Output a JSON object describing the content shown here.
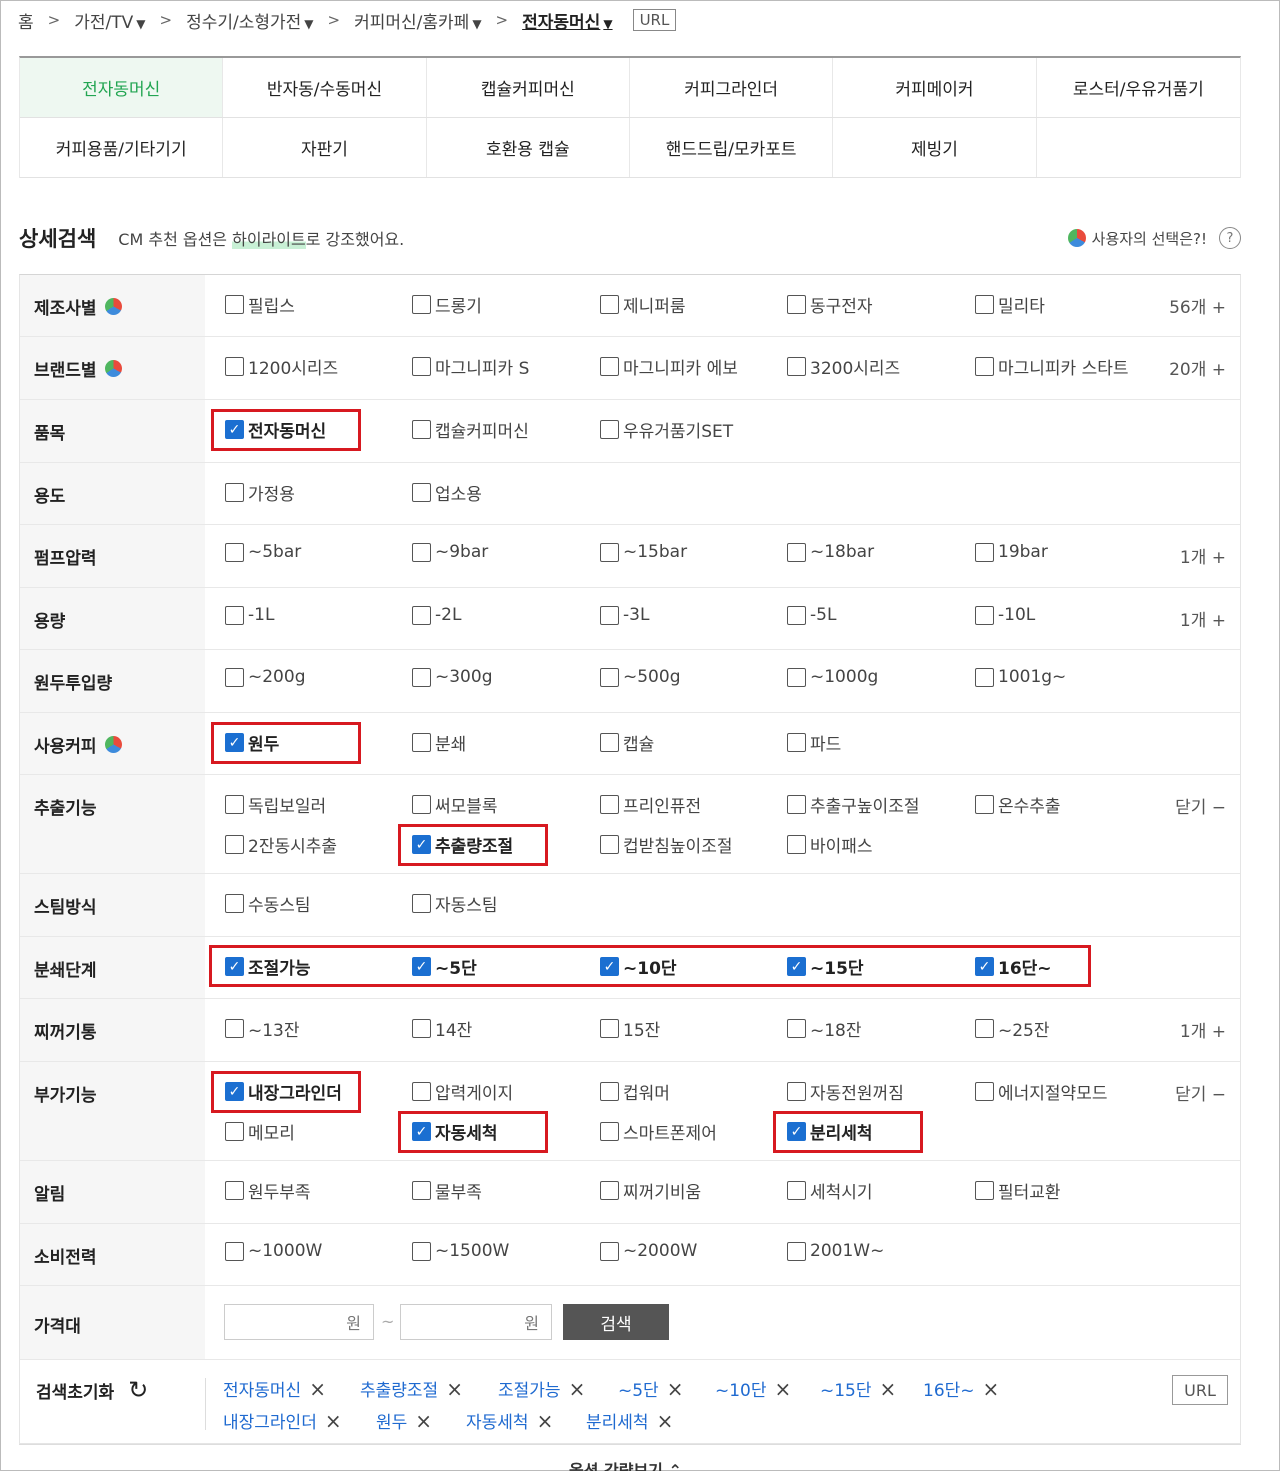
{
  "breadcrumb": {
    "home": "홈",
    "items": [
      "가전/TV",
      "정수기/소형가전",
      "커피머신/홈카페",
      "전자동머신"
    ],
    "url_label": "URL"
  },
  "categories": [
    [
      "전자동머신",
      "반자동/수동머신",
      "캡슐커피머신",
      "커피그라인더",
      "커피메이커",
      "로스터/우유거품기"
    ],
    [
      "커피용품/기타기기",
      "자판기",
      "호환용 캡슐",
      "핸드드립/모카포트",
      "제빙기",
      ""
    ]
  ],
  "detail": {
    "title": "상세검색",
    "note_pre": "CM 추천 옵션은 ",
    "note_hl": "하이라이트",
    "note_post": "로 강조했어요.",
    "user_choice": "사용자의 선택은?!",
    "help": "?"
  },
  "filters": [
    {
      "label": "제조사별",
      "pie": true,
      "more": "56개 +",
      "opts": [
        [
          "필립스",
          false
        ],
        [
          "드롱기",
          false
        ],
        [
          "제니퍼룸",
          false
        ],
        [
          "동구전자",
          false
        ],
        [
          "밀리타",
          false
        ]
      ]
    },
    {
      "label": "브랜드별",
      "pie": true,
      "more": "20개 +",
      "opts": [
        [
          "1200시리즈",
          false
        ],
        [
          "마그니피카 S",
          false
        ],
        [
          "마그니피카 에보",
          false
        ],
        [
          "3200시리즈",
          false
        ],
        [
          "마그니피카 스타트",
          false
        ]
      ]
    },
    {
      "label": "품목",
      "pie": false,
      "more": "",
      "opts": [
        [
          "전자동머신",
          true
        ],
        [
          "캡슐커피머신",
          false
        ],
        [
          "우유거품기SET",
          false
        ]
      ]
    },
    {
      "label": "용도",
      "pie": false,
      "more": "",
      "opts": [
        [
          "가정용",
          false
        ],
        [
          "업소용",
          false
        ]
      ]
    },
    {
      "label": "펌프압력",
      "pie": false,
      "more": "1개 +",
      "opts": [
        [
          "~5bar",
          false
        ],
        [
          "~9bar",
          false
        ],
        [
          "~15bar",
          false
        ],
        [
          "~18bar",
          false
        ],
        [
          "19bar",
          false
        ]
      ]
    },
    {
      "label": "용량",
      "pie": false,
      "more": "1개 +",
      "opts": [
        [
          "-1L",
          false
        ],
        [
          "-2L",
          false
        ],
        [
          "-3L",
          false
        ],
        [
          "-5L",
          false
        ],
        [
          "-10L",
          false
        ]
      ]
    },
    {
      "label": "원두투입량",
      "pie": false,
      "more": "",
      "opts": [
        [
          "~200g",
          false
        ],
        [
          "~300g",
          false
        ],
        [
          "~500g",
          false
        ],
        [
          "~1000g",
          false
        ],
        [
          "1001g~",
          false
        ]
      ]
    },
    {
      "label": "사용커피",
      "pie": true,
      "more": "",
      "opts": [
        [
          "원두",
          true
        ],
        [
          "분쇄",
          false
        ],
        [
          "캡슐",
          false
        ],
        [
          "파드",
          false
        ]
      ]
    },
    {
      "label": "추출기능",
      "pie": false,
      "more": "닫기 −",
      "opts": [
        [
          "독립보일러",
          false
        ],
        [
          "써모블록",
          false
        ],
        [
          "프리인퓨전",
          false
        ],
        [
          "추출구높이조절",
          false
        ],
        [
          "온수추출",
          false
        ],
        [
          "2잔동시추출",
          false
        ],
        [
          "추출량조절",
          true
        ],
        [
          "컵받침높이조절",
          false
        ],
        [
          "바이패스",
          false
        ]
      ]
    },
    {
      "label": "스팀방식",
      "pie": false,
      "more": "",
      "opts": [
        [
          "수동스팀",
          false
        ],
        [
          "자동스팀",
          false
        ]
      ]
    },
    {
      "label": "분쇄단계",
      "pie": false,
      "more": "",
      "opts": [
        [
          "조절가능",
          true
        ],
        [
          "~5단",
          true
        ],
        [
          "~10단",
          true
        ],
        [
          "~15단",
          true
        ],
        [
          "16단~",
          true
        ]
      ]
    },
    {
      "label": "찌꺼기통",
      "pie": false,
      "more": "1개 +",
      "opts": [
        [
          "~13잔",
          false
        ],
        [
          "14잔",
          false
        ],
        [
          "15잔",
          false
        ],
        [
          "~18잔",
          false
        ],
        [
          "~25잔",
          false
        ]
      ]
    },
    {
      "label": "부가기능",
      "pie": false,
      "more": "닫기 −",
      "opts": [
        [
          "내장그라인더",
          true
        ],
        [
          "압력게이지",
          false
        ],
        [
          "컵워머",
          false
        ],
        [
          "자동전원꺼짐",
          false
        ],
        [
          "에너지절약모드",
          false
        ],
        [
          "메모리",
          false
        ],
        [
          "자동세척",
          true
        ],
        [
          "스마트폰제어",
          false
        ],
        [
          "분리세척",
          true
        ]
      ]
    },
    {
      "label": "알림",
      "pie": false,
      "more": "",
      "opts": [
        [
          "원두부족",
          false
        ],
        [
          "물부족",
          false
        ],
        [
          "찌꺼기비움",
          false
        ],
        [
          "세척시기",
          false
        ],
        [
          "필터교환",
          false
        ]
      ]
    },
    {
      "label": "소비전력",
      "pie": false,
      "more": "",
      "opts": [
        [
          "~1000W",
          false
        ],
        [
          "~1500W",
          false
        ],
        [
          "~2000W",
          false
        ],
        [
          "2001W~",
          false
        ]
      ]
    }
  ],
  "price": {
    "label": "가격대",
    "unit_min": "원",
    "tilde": "~",
    "unit_max": "원",
    "search": "검색"
  },
  "reset": {
    "label": "검색초기화",
    "tags_row1": [
      "전자동머신",
      "추출량조절",
      "조절가능",
      "~5단",
      "~10단",
      "~15단",
      "16단~"
    ],
    "tags_row2": [
      "내장그라인더",
      "원두",
      "자동세척",
      "분리세척"
    ],
    "url_label": "URL"
  },
  "more_label": "옵션 간략보기 ⌃"
}
